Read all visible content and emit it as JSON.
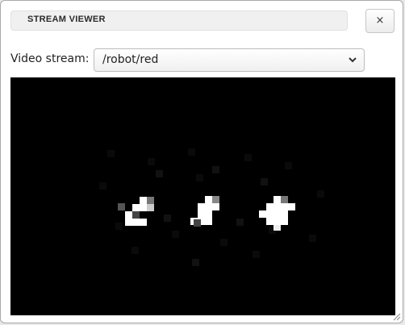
{
  "window": {
    "title": "STREAM VIEWER",
    "close_label": "×"
  },
  "stream": {
    "label": "Video stream:",
    "selected": "/robot/red"
  },
  "icons": {
    "close": "close-icon",
    "dropdown": "chevron-down-icon",
    "resize": "resize-grip-icon"
  },
  "colors": {
    "video_background": "#000000",
    "blob": "#ffffff"
  }
}
